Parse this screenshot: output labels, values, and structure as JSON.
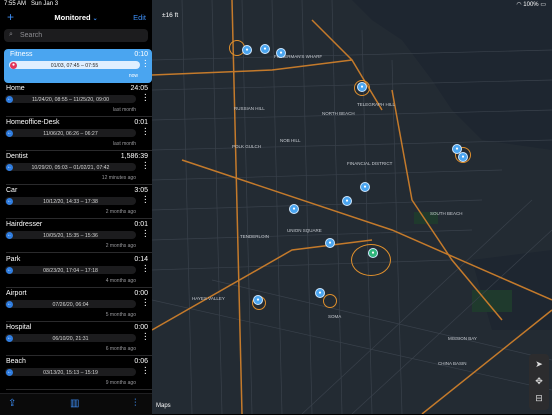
{
  "status": {
    "time": "7:55 AM",
    "date": "Sun Jan 3",
    "battery": "100%"
  },
  "topbar": {
    "plus": "+",
    "title": "Monitored",
    "edit": "Edit"
  },
  "search": {
    "placeholder": "Search"
  },
  "items": [
    {
      "name": "Fitness",
      "duration": "0:10",
      "range": "01/03, 07:45 – 07:55",
      "ago": "now"
    },
    {
      "name": "Home",
      "duration": "24:05",
      "range": "11/24/20, 08:55 – 11/25/20, 09:00",
      "ago": "last month"
    },
    {
      "name": "Homeoffice-Desk",
      "duration": "0:01",
      "range": "11/06/20, 06:26 – 06:27",
      "ago": "last month"
    },
    {
      "name": "Dentist",
      "duration": "1,586:39",
      "range": "10/29/20, 05:03 – 01/02/21, 07:42",
      "ago": "12 minutes ago"
    },
    {
      "name": "Car",
      "duration": "3:05",
      "range": "10/12/20, 14:33 – 17:38",
      "ago": "2 months ago"
    },
    {
      "name": "Hairdresser",
      "duration": "0:01",
      "range": "10/05/20, 15:35 – 15:36",
      "ago": "2 months ago"
    },
    {
      "name": "Park",
      "duration": "0:14",
      "range": "08/23/20, 17:04 – 17:18",
      "ago": "4 months ago"
    },
    {
      "name": "Airport",
      "duration": "0:00",
      "range": "07/26/20, 06:04",
      "ago": "5 months ago"
    },
    {
      "name": "Hospital",
      "duration": "0:00",
      "range": "06/10/20, 21:31",
      "ago": "6 months ago"
    },
    {
      "name": "Beach",
      "duration": "0:06",
      "range": "03/13/20, 15:13 – 15:19",
      "ago": "9 months ago"
    }
  ],
  "map": {
    "scale": "±16 ft",
    "logo": "Maps",
    "legal": "Legal",
    "labels": [
      "FISHERMAN'S WHARF",
      "TELEGRAPH HILL",
      "NORTH BEACH",
      "RUSSIAN HILL",
      "NOB HILL",
      "POLK GULCH",
      "FINANCIAL DISTRICT",
      "SOUTH BEACH",
      "UNION SQUARE",
      "TENDERLOIN",
      "SOMA",
      "HAYES VALLEY",
      "MISSION BAY",
      "CHINA BASIN"
    ]
  },
  "colors": {
    "accent": "#3d8ef5",
    "selected": "#4aa5f0",
    "ring": "#e0902d",
    "map_bg": "#232b33"
  }
}
